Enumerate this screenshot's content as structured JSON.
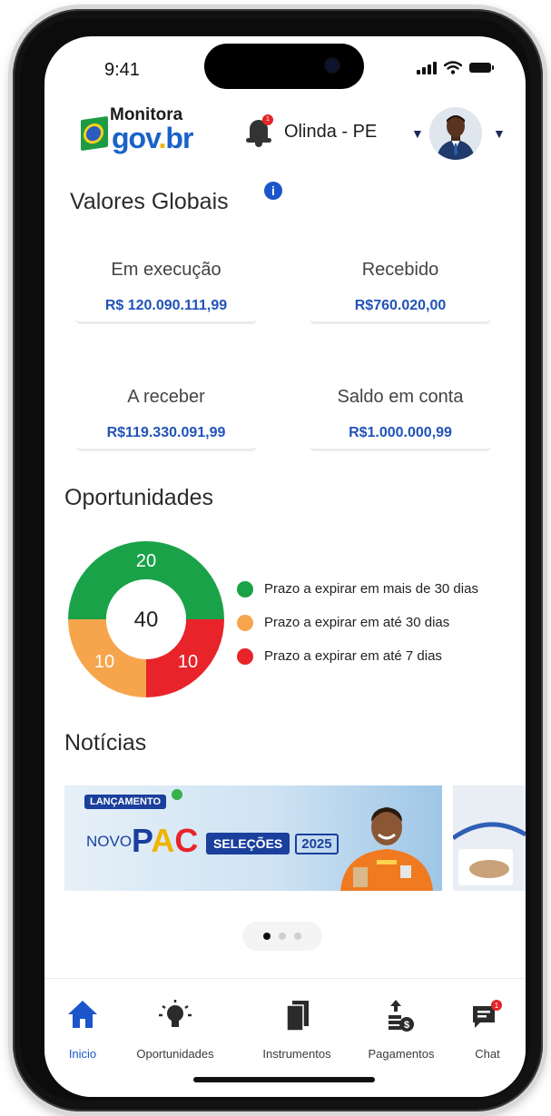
{
  "status": {
    "time": "9:41"
  },
  "header": {
    "logo_top": "Monitora",
    "logo_gov": "gov",
    "logo_dot": ".",
    "logo_br": "br",
    "notification_count": "1",
    "city": "Olinda - PE"
  },
  "valores": {
    "title": "Valores Globais",
    "cards": [
      {
        "label": "Em execução",
        "value": "R$ 120.090.111,99"
      },
      {
        "label": "Recebido",
        "value": "R$760.020,00"
      },
      {
        "label": "A receber",
        "value": "R$119.330.091,99"
      },
      {
        "label": "Saldo em conta",
        "value": "R$1.000.000,99"
      }
    ]
  },
  "oportunidades": {
    "title": "Oportunidades",
    "total": "40",
    "legend": [
      {
        "label": "Prazo a expirar em mais de 30 dias",
        "color": "#1aa248"
      },
      {
        "label": "Prazo a expirar em até 30 dias",
        "color": "#f7a54d"
      },
      {
        "label": "Prazo a expirar em até 7 dias",
        "color": "#e8232a"
      }
    ]
  },
  "chart_data": {
    "type": "pie",
    "categories": [
      "Prazo a expirar em mais de 30 dias",
      "Prazo a expirar em até 30 dias",
      "Prazo a expirar em até 7 dias"
    ],
    "values": [
      20,
      10,
      10
    ],
    "labels": [
      "20",
      "10",
      "10"
    ],
    "colors": [
      "#1aa248",
      "#f7a54d",
      "#e8232a"
    ],
    "center_label": "40",
    "legend_position": "right"
  },
  "noticias": {
    "title": "Notícias",
    "banner": {
      "badge": "LANÇAMENTO",
      "novo": "NOVO",
      "pac_p": "P",
      "pac_a": "A",
      "pac_c": "C",
      "selecoes": "SELEÇÕES",
      "year": "2025"
    }
  },
  "tabs": [
    {
      "label": "Inicio",
      "icon": "home-icon"
    },
    {
      "label": "Oportunidades",
      "icon": "lightbulb-icon"
    },
    {
      "label": "Instrumentos",
      "icon": "documents-icon"
    },
    {
      "label": "Pagamentos",
      "icon": "payment-icon"
    },
    {
      "label": "Chat",
      "icon": "chat-icon"
    }
  ],
  "chat_badge": "1",
  "colors": {
    "accent": "#1b55c9",
    "value_blue": "#2153b8"
  }
}
